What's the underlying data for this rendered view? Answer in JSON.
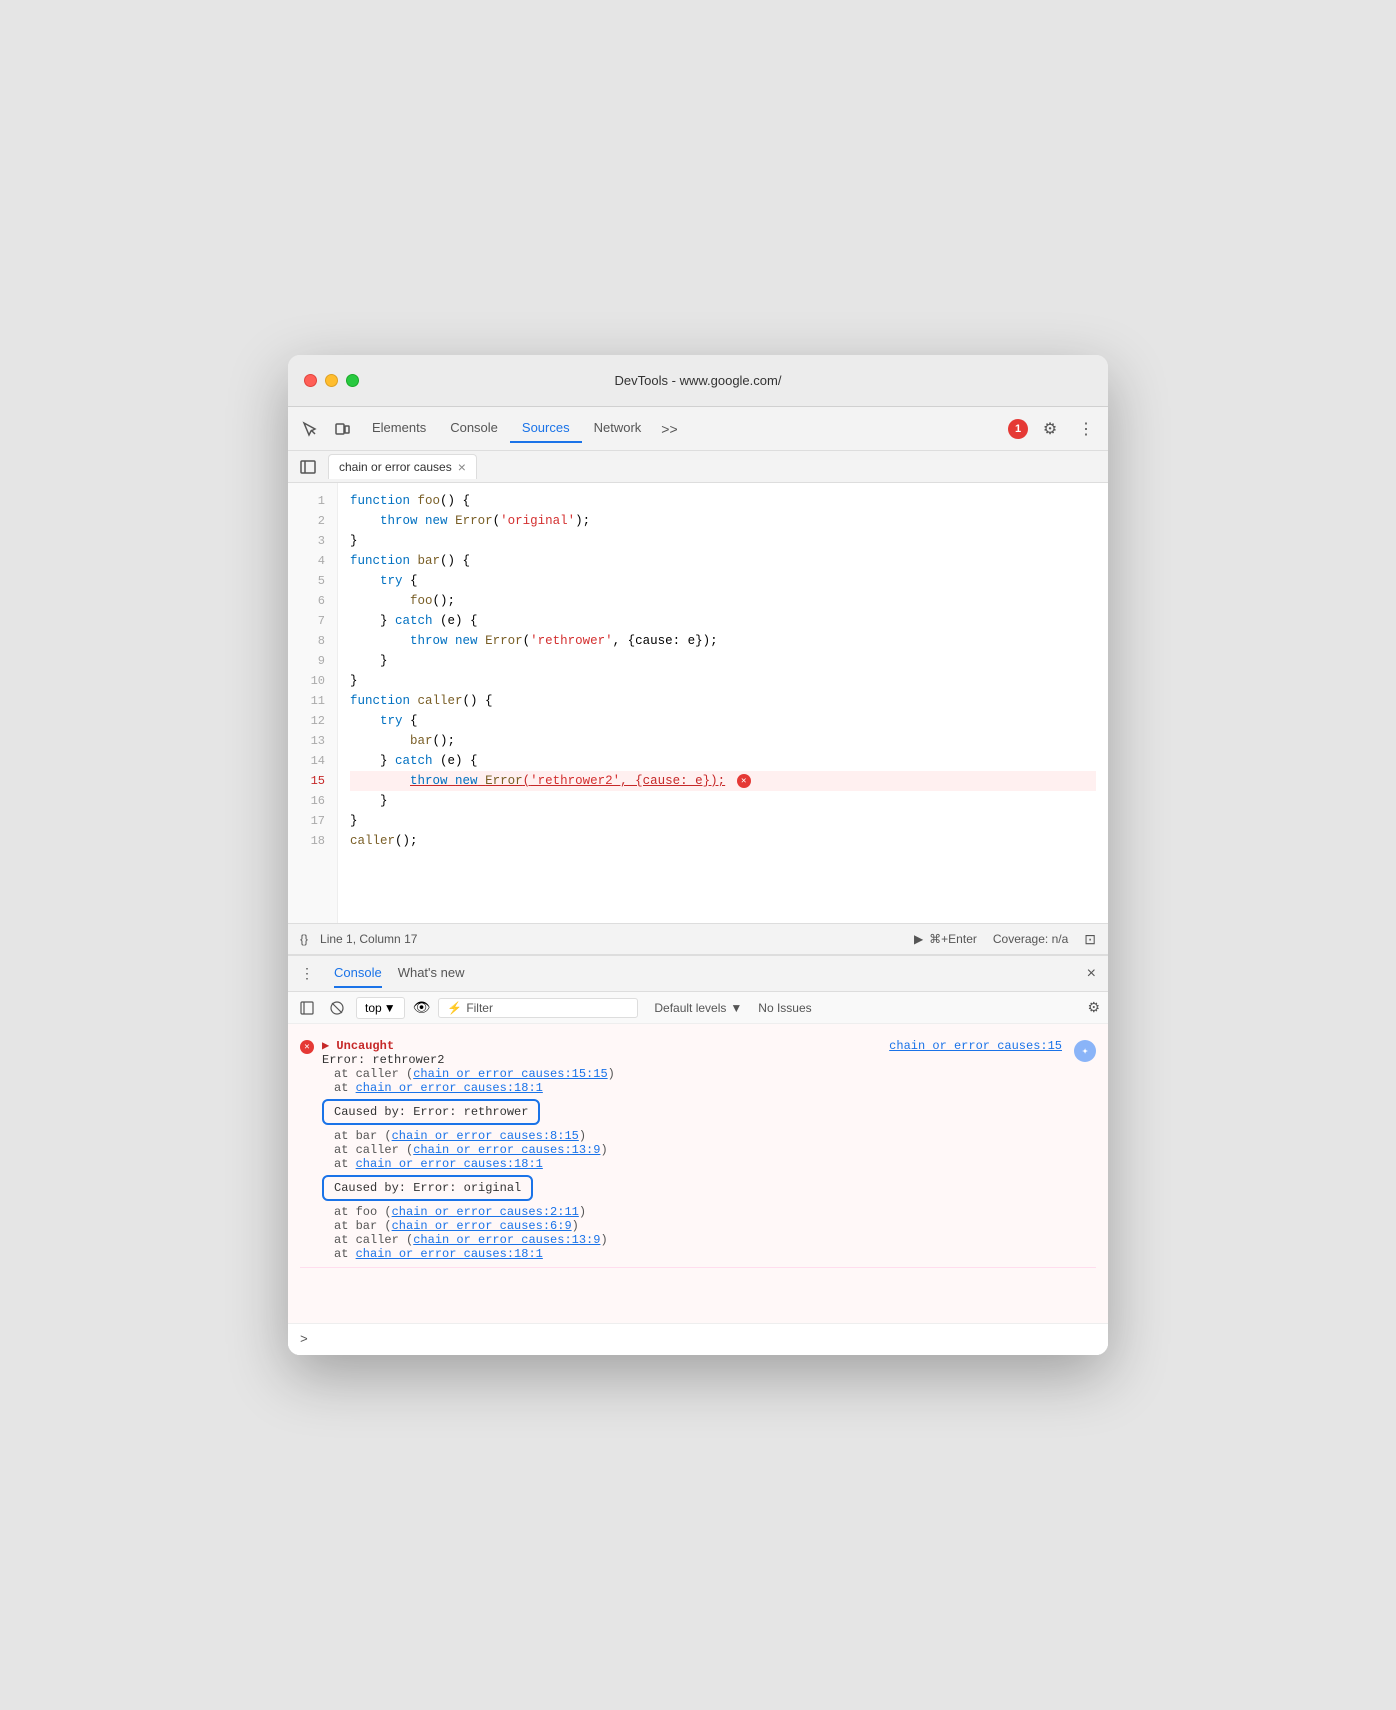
{
  "window": {
    "title": "DevTools - www.google.com/"
  },
  "title_bar": {
    "close_label": "",
    "minimize_label": "",
    "maximize_label": ""
  },
  "nav": {
    "tabs": [
      {
        "id": "elements",
        "label": "Elements",
        "active": false
      },
      {
        "id": "console",
        "label": "Console",
        "active": false
      },
      {
        "id": "sources",
        "label": "Sources",
        "active": true
      },
      {
        "id": "network",
        "label": "Network",
        "active": false
      },
      {
        "id": "more",
        "label": ">>",
        "active": false
      }
    ],
    "error_count": "1"
  },
  "file_tab": {
    "label": "chain or error causes",
    "close_icon": "×"
  },
  "code": {
    "lines": [
      {
        "num": 1,
        "text": "function foo() {"
      },
      {
        "num": 2,
        "text": "    throw new Error('original');"
      },
      {
        "num": 3,
        "text": "}"
      },
      {
        "num": 4,
        "text": "function bar() {"
      },
      {
        "num": 5,
        "text": "    try {"
      },
      {
        "num": 6,
        "text": "        foo();"
      },
      {
        "num": 7,
        "text": "    } catch (e) {"
      },
      {
        "num": 8,
        "text": "        throw new Error('rethrower', {cause: e});"
      },
      {
        "num": 9,
        "text": "    }"
      },
      {
        "num": 10,
        "text": "}"
      },
      {
        "num": 11,
        "text": "function caller() {"
      },
      {
        "num": 12,
        "text": "    try {"
      },
      {
        "num": 13,
        "text": "        bar();"
      },
      {
        "num": 14,
        "text": "    } catch (e) {"
      },
      {
        "num": 15,
        "text": "        throw new Error('rethrower2', {cause: e});",
        "error": true
      },
      {
        "num": 16,
        "text": "    }"
      },
      {
        "num": 17,
        "text": "}"
      },
      {
        "num": 18,
        "text": "caller();"
      }
    ]
  },
  "status_bar": {
    "format_label": "{}",
    "position_label": "Line 1, Column 17",
    "run_label": "⌘+Enter",
    "coverage_label": "Coverage: n/a"
  },
  "console_panel": {
    "menu_icon": "⋮",
    "tabs": [
      {
        "id": "console",
        "label": "Console",
        "active": true
      },
      {
        "id": "whats_new",
        "label": "What's new",
        "active": false
      }
    ],
    "close_icon": "×",
    "toolbar": {
      "sidebar_icon": "⊟",
      "clear_icon": "⊘",
      "top_label": "top",
      "eye_icon": "👁",
      "filter_icon": "⚡",
      "filter_placeholder": "Filter",
      "levels_label": "Default levels",
      "no_issues_label": "No Issues",
      "settings_icon": "⚙"
    },
    "entries": [
      {
        "type": "error",
        "header": "▶ Uncaught",
        "link": "chain or error causes:15",
        "lines": [
          "Error: rethrower2",
          "    at caller (chain or error causes:15:15)",
          "    at chain or error causes:18:1"
        ],
        "caused_by_1": {
          "label": "Caused by: Error: rethrower",
          "lines": [
            "    at bar (chain or error causes:8:15)",
            "    at caller (chain or error causes:13:9)",
            "    at chain or error causes:18:1"
          ]
        },
        "caused_by_2": {
          "label": "Caused by: Error: original",
          "lines": [
            "    at foo (chain or error causes:2:11)",
            "    at bar (chain or error causes:6:9)",
            "    at caller (chain or error causes:13:9)",
            "    at chain or error causes:18:1"
          ]
        }
      }
    ],
    "links": {
      "caused1_link1": "chain or error causes:8:15",
      "caused1_link2": "chain or error causes:13:9",
      "caused1_link3": "chain or error causes:18:1",
      "caused2_link1": "chain or error causes:2:11",
      "caused2_link2": "chain or error causes:6:9",
      "caused2_link3": "chain or error causes:13:9",
      "caused2_link4": "chain or error causes:18:1"
    }
  },
  "console_input": {
    "prompt": ">",
    "placeholder": ""
  }
}
